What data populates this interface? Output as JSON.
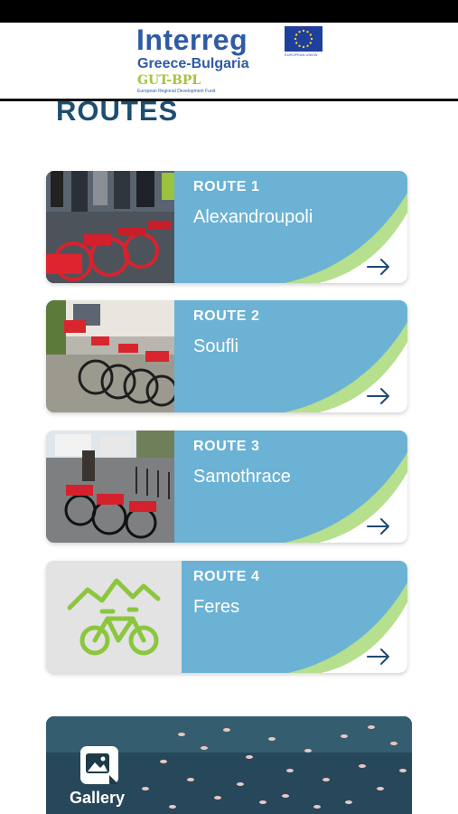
{
  "header": {
    "logo_title": "Interreg",
    "logo_subtitle": "Greece-Bulgaria",
    "logo_code": "GUT-BPL",
    "logo_fund": "European Regional Development Fund",
    "eu_label": "EUROPEAN UNION"
  },
  "page": {
    "title": "ROUTES"
  },
  "routes": [
    {
      "number": "ROUTE 1",
      "name": "Alexandroupoli",
      "image": "red-bikes-crowd-photo"
    },
    {
      "number": "ROUTE 2",
      "name": "Soufli",
      "image": "parked-red-bikes-photo"
    },
    {
      "number": "ROUTE 3",
      "name": "Samothrace",
      "image": "bikes-by-village-photo"
    },
    {
      "number": "ROUTE 4",
      "name": "Feres",
      "image": "mountain-bicycle-icon"
    }
  ],
  "gallery": {
    "label": "Gallery",
    "icon": "image-gallery-icon",
    "image": "flamingos-on-water-photo"
  },
  "colors": {
    "card_blue": "#6cb2d4",
    "swoosh_green": "#b6df8e",
    "title_navy": "#1d4e72",
    "logo_blue": "#2e5ba4",
    "logo_green": "#a7c43a",
    "icon_green": "#8cc63f"
  }
}
